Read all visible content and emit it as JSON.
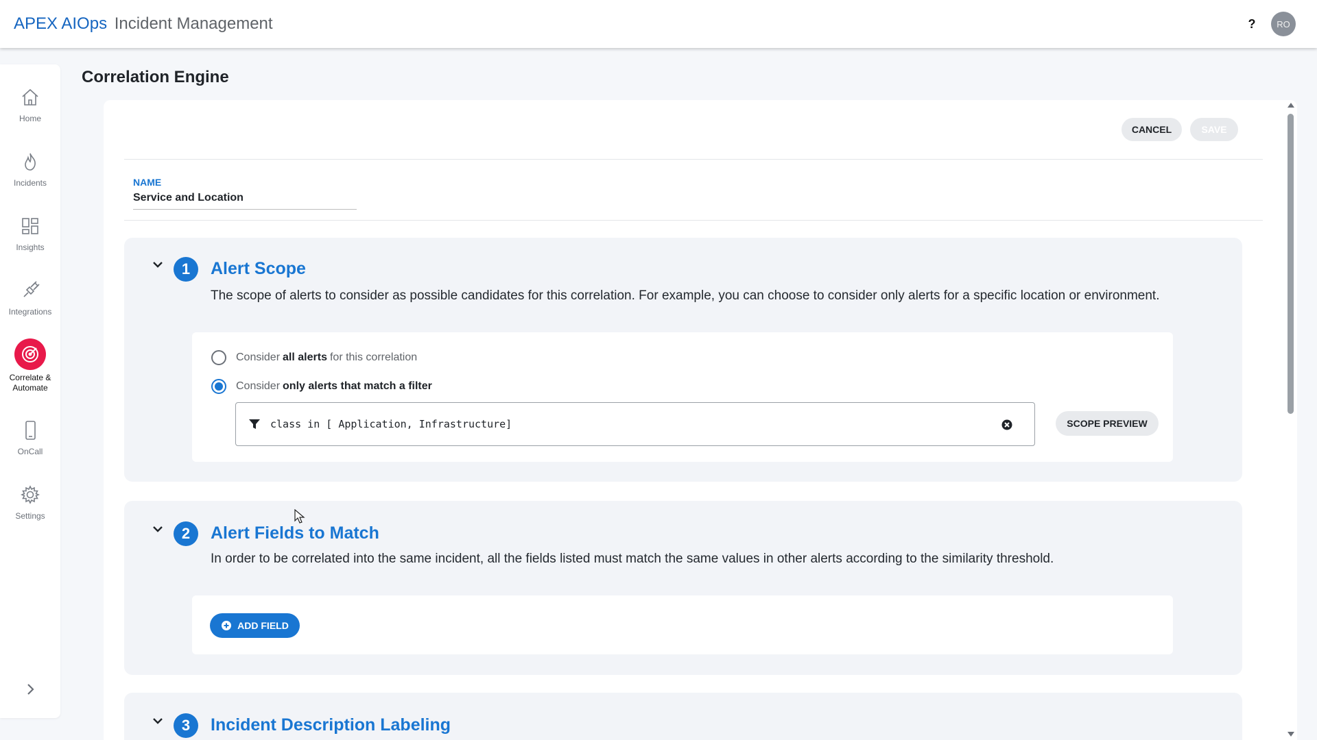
{
  "header": {
    "brand": "APEX AIOps",
    "app_name": "Incident Management",
    "help_label": "?",
    "avatar_initials": "RO"
  },
  "sidebar": {
    "items": [
      {
        "label": "Home",
        "icon": "home-icon"
      },
      {
        "label": "Incidents",
        "icon": "flame-icon"
      },
      {
        "label": "Insights",
        "icon": "grid-icon"
      },
      {
        "label": "Integrations",
        "icon": "plug-icon"
      },
      {
        "label": "Correlate & Automate",
        "icon": "target-icon",
        "active": true
      },
      {
        "label": "OnCall",
        "icon": "phone-icon"
      },
      {
        "label": "Settings",
        "icon": "gear-icon"
      }
    ],
    "active_color": "#e8194a"
  },
  "page": {
    "title": "Correlation Engine",
    "cancel_label": "CANCEL",
    "save_label": "SAVE"
  },
  "name_field": {
    "label": "NAME",
    "value": "Service and Location"
  },
  "sections": [
    {
      "step": "1",
      "title": "Alert Scope",
      "description": "The scope of alerts to consider as possible candidates for this correlation. For example, you can choose to consider only alerts for a specific location or environment.",
      "options": [
        {
          "prefix": "Consider",
          "bold": "all alerts",
          "suffix": "for this correlation",
          "selected": false
        },
        {
          "prefix": "Consider",
          "bold": "only alerts that match a filter",
          "suffix": "",
          "selected": true
        }
      ],
      "filter_value": "class in [ Application, Infrastructure]",
      "scope_preview_label": "SCOPE PREVIEW"
    },
    {
      "step": "2",
      "title": "Alert Fields to Match",
      "description": "In order to be correlated into the same incident, all the fields listed must match the same values in other alerts according to the similarity threshold.",
      "add_field_label": "ADD FIELD"
    },
    {
      "step": "3",
      "title": "Incident Description Labeling"
    }
  ],
  "colors": {
    "accent": "#1976d2",
    "page_bg": "#f5f7fa",
    "section_bg": "#f2f4f8"
  }
}
